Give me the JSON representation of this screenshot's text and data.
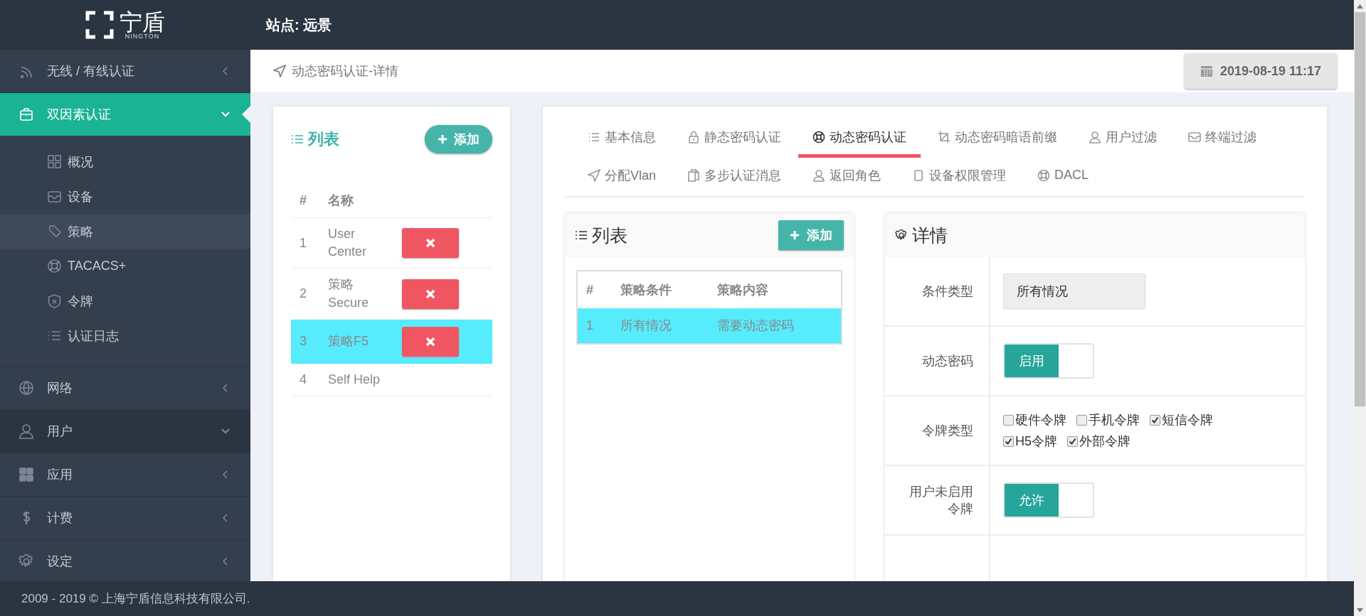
{
  "header": {
    "logo_text": "宁盾",
    "logo_subtext": "NINGTON",
    "site_label": "站点: 远景"
  },
  "sidebar": {
    "items": [
      {
        "label": "无线 / 有线认证",
        "selected": false,
        "expanded": false,
        "hovered": false
      },
      {
        "label": "双因素认证",
        "selected": true,
        "expanded": true,
        "hovered": false,
        "children": [
          {
            "label": "概况",
            "selected": false
          },
          {
            "label": "设备",
            "selected": false
          },
          {
            "label": "策略",
            "selected": true
          },
          {
            "label": "TACACS+",
            "selected": false
          },
          {
            "label": "令牌",
            "selected": false
          },
          {
            "label": "认证日志",
            "selected": false
          }
        ]
      },
      {
        "label": "网络",
        "selected": false,
        "expanded": false,
        "hovered": false
      },
      {
        "label": "用户",
        "selected": false,
        "expanded": true,
        "hovered": true
      },
      {
        "label": "应用",
        "selected": false,
        "expanded": false,
        "hovered": false
      },
      {
        "label": "计费",
        "selected": false,
        "expanded": false,
        "hovered": false
      },
      {
        "label": "设定",
        "selected": false,
        "expanded": false,
        "hovered": false
      }
    ]
  },
  "breadcrumb": {
    "title": "动态密码认证-详情",
    "datetime": "2019-08-19 11:17"
  },
  "policy_list": {
    "title": "列表",
    "add_button": "添加",
    "columns": [
      "#",
      "名称"
    ],
    "rows": [
      {
        "index": "1",
        "name": "User Center",
        "selected": false,
        "deletable": true
      },
      {
        "index": "2",
        "name": "策略 Secure",
        "selected": false,
        "deletable": true
      },
      {
        "index": "3",
        "name": "策略F5",
        "selected": true,
        "deletable": true
      },
      {
        "index": "4",
        "name": "Self Help",
        "selected": false,
        "deletable": false
      }
    ]
  },
  "tabs": [
    {
      "label": "基本信息",
      "selected": false
    },
    {
      "label": "静态密码认证",
      "selected": false
    },
    {
      "label": "动态密码认证",
      "selected": true
    },
    {
      "label": "动态密码暗语前缀",
      "selected": false
    },
    {
      "label": "用户过滤",
      "selected": false
    },
    {
      "label": "终端过滤",
      "selected": false
    },
    {
      "label": "分配Vlan",
      "selected": false
    },
    {
      "label": "多步认证消息",
      "selected": false
    },
    {
      "label": "返回角色",
      "selected": false
    },
    {
      "label": "设备权限管理",
      "selected": false
    },
    {
      "label": "DACL",
      "selected": false
    }
  ],
  "rules": {
    "title": "列表",
    "add_button": "添加",
    "columns": [
      "#",
      "策略条件",
      "策略内容"
    ],
    "rows": [
      {
        "cells": [
          "1",
          "所有情况",
          "需要动态密码"
        ],
        "selected": true
      }
    ]
  },
  "detail": {
    "title": "详情",
    "fields": [
      {
        "kind": "readonly",
        "label": "条件类型",
        "value": "所有情况"
      },
      {
        "kind": "toggle",
        "label": "动态密码",
        "value": "启用",
        "on": true
      },
      {
        "kind": "checkboxes",
        "label": "令牌类型",
        "options": [
          {
            "label": "硬件令牌",
            "checked": false
          },
          {
            "label": "手机令牌",
            "checked": false
          },
          {
            "label": "短信令牌",
            "checked": true
          },
          {
            "label": "H5令牌",
            "checked": true
          },
          {
            "label": "外部令牌",
            "checked": true
          }
        ]
      },
      {
        "kind": "toggle",
        "label": "用户未启用令牌",
        "value": "允许",
        "on": true
      }
    ]
  },
  "footer": {
    "text": "2009 - 2019 © 上海宁盾信息科技有限公司."
  }
}
